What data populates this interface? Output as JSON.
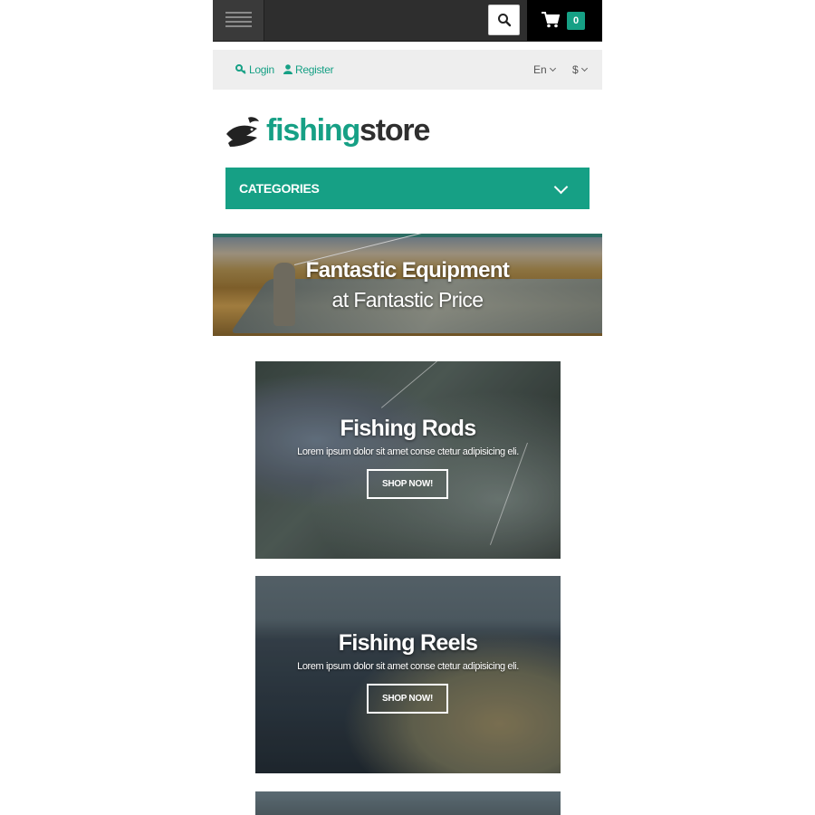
{
  "header": {
    "cart_count": "0"
  },
  "account": {
    "login": "Login",
    "register": "Register",
    "language": "En",
    "currency": "$"
  },
  "logo": {
    "part1": "fishing",
    "part2": "store"
  },
  "categories": {
    "label": "CATEGORIES"
  },
  "hero": {
    "title": "Fantastic Equipment",
    "subtitle": "at Fantastic Price"
  },
  "promos": [
    {
      "title": "Fishing Rods",
      "desc": "Lorem ipsum dolor sit amet conse ctetur adipisicing eli.",
      "button": "SHOP NOW!"
    },
    {
      "title": "Fishing Reels",
      "desc": "Lorem ipsum dolor sit amet conse ctetur adipisicing eli.",
      "button": "SHOP NOW!"
    }
  ],
  "colors": {
    "accent": "#16a085",
    "topbar": "#2e2e2e",
    "account_bar": "#eeeeee"
  },
  "icons": [
    "menu-icon",
    "search-icon",
    "cart-icon",
    "key-icon",
    "user-icon",
    "chevron-down-icon",
    "fish-logo-icon"
  ]
}
